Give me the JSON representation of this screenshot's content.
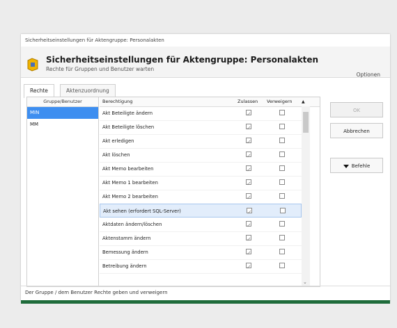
{
  "window": {
    "title": "Sicherheitseinstellungen für Aktengruppe: Personalakten"
  },
  "header": {
    "title": "Sicherheitseinstellungen für Aktengruppe: Personalakten",
    "subtitle": "Rechte für Gruppen und Benutzer warten",
    "options_label": "Optionen"
  },
  "tabs": [
    {
      "label": "Rechte"
    },
    {
      "label": "Aktenzuordnung"
    }
  ],
  "userlist": {
    "header": "Gruppe/Benutzer",
    "items": [
      {
        "label": "MIN",
        "selected": true
      },
      {
        "label": "MM",
        "selected": false
      }
    ]
  },
  "grid": {
    "headers": [
      "Berechtigung",
      "Zulassen",
      "Verweigern"
    ],
    "rows": [
      {
        "label": "Akt Beteiligte ändern",
        "allow": true,
        "deny": false
      },
      {
        "label": "Akt Beteiligte löschen",
        "allow": true,
        "deny": false
      },
      {
        "label": "Akt erledigen",
        "allow": true,
        "deny": false
      },
      {
        "label": "Akt löschen",
        "allow": true,
        "deny": false
      },
      {
        "label": "Akt Memo bearbeiten",
        "allow": true,
        "deny": false
      },
      {
        "label": "Akt Memo 1 bearbeiten",
        "allow": true,
        "deny": false
      },
      {
        "label": "Akt Memo 2 bearbeiten",
        "allow": true,
        "deny": false
      },
      {
        "label": "Akt sehen (erfordert SQL-Server)",
        "allow": true,
        "deny": false,
        "selected": true
      },
      {
        "label": "Aktdaten ändern/löschen",
        "allow": true,
        "deny": false
      },
      {
        "label": "Aktenstamm ändern",
        "allow": true,
        "deny": false
      },
      {
        "label": "Bemessung ändern",
        "allow": true,
        "deny": false
      },
      {
        "label": "Betreibung ändern",
        "allow": true,
        "deny": false
      }
    ]
  },
  "buttons": {
    "ok": "OK",
    "cancel": "Abbrechen",
    "commands": "Befehle"
  },
  "status": {
    "text": "Der Gruppe / dem Benutzer Rechte geben und verweigern"
  }
}
